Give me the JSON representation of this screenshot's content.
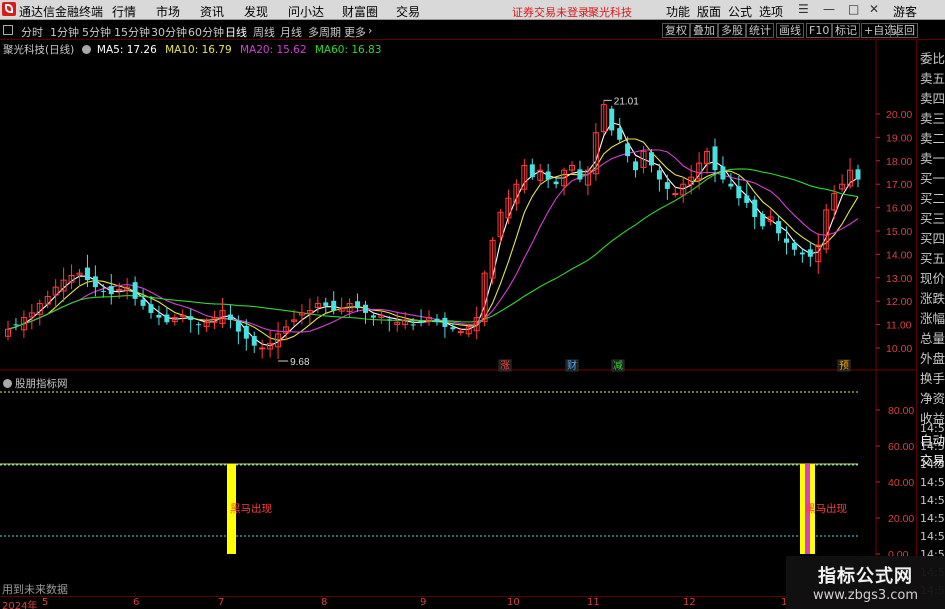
{
  "menubar": {
    "app_name": "通达信金融终端",
    "items": [
      "行情",
      "市场",
      "资讯",
      "发现",
      "问小达",
      "财富圈",
      "交易"
    ],
    "notice": "证券交易未登录",
    "stock_name": "聚光科技",
    "right_items": [
      "功能",
      "版面",
      "公式",
      "选项"
    ],
    "guest": "游客"
  },
  "toolbar": {
    "periods": [
      "分时",
      "1分钟",
      "5分钟",
      "15分钟",
      "30分钟",
      "60分钟",
      "日线",
      "周线",
      "月线",
      "多周期",
      "更多"
    ],
    "active_period": "日线",
    "right_buttons": [
      "复权",
      "叠加",
      "多股",
      "统计",
      "画线",
      "F10",
      "标记",
      "+自选",
      "返回"
    ]
  },
  "main_title": {
    "stock": "聚光科技(日线)",
    "ma5": "MA5: 17.26",
    "ma10": "MA10: 16.79",
    "ma20": "MA20: 15.62",
    "ma60": "MA60: 16.83",
    "colors": {
      "ma5": "#ffffff",
      "ma10": "#e8e64a",
      "ma20": "#d63fd6",
      "ma60": "#2ed82e",
      "up": "#ff3b3b",
      "down": "#4be0e0"
    }
  },
  "price_axis": [
    "20.00",
    "19.00",
    "18.00",
    "17.00",
    "16.00",
    "15.00",
    "14.00",
    "13.00",
    "12.00",
    "11.00",
    "10.00"
  ],
  "annotations": {
    "high": "21.01",
    "low": "9.68"
  },
  "event_markers": [
    {
      "text": "涨",
      "color": "#ff4040"
    },
    {
      "text": "财",
      "color": "#4bb0ff"
    },
    {
      "text": "减",
      "color": "#2ed82e"
    },
    {
      "text": "预",
      "color": "#ffaa00"
    }
  ],
  "subchart": {
    "title": "股朋指标网",
    "axis": [
      "80.00",
      "60.00",
      "40.00",
      "20.00",
      "0.00"
    ],
    "signal_label": "黑马出现"
  },
  "right_column": {
    "labels": [
      "委比",
      "卖五",
      "卖四",
      "卖三",
      "卖二",
      "卖一",
      "买一",
      "买二",
      "买三",
      "买四",
      "买五",
      "现价",
      "涨跌",
      "涨幅",
      "总量",
      "外盘",
      "换手",
      "净资",
      "收益",
      "自动",
      "交易"
    ],
    "times": [
      "14:56",
      "14:56",
      "14:56",
      "14:56",
      "14:56",
      "14:56",
      "14:56",
      "14:56",
      "14:56",
      "14:56"
    ]
  },
  "bottom_note": "用到未来数据",
  "x_axis": [
    "2024年",
    "5",
    "6",
    "7",
    "8",
    "9",
    "10",
    "11",
    "12",
    "1"
  ],
  "watermark": {
    "title": "指标公式网",
    "url": "www.zbgs3.com"
  },
  "chart_data": {
    "type": "candlestick",
    "price_range": [
      9.5,
      21.2
    ],
    "candles_close_approx": [
      10.8,
      11.0,
      11.3,
      11.5,
      11.9,
      12.2,
      12.6,
      12.9,
      13.1,
      13.2,
      12.9,
      12.6,
      12.4,
      12.3,
      12.5,
      12.6,
      12.1,
      11.8,
      11.5,
      11.3,
      11.1,
      11.3,
      11.4,
      11.2,
      11.0,
      11.1,
      11.3,
      11.6,
      11.2,
      10.7,
      10.4,
      10.1,
      10.0,
      10.2,
      10.6,
      10.9,
      11.2,
      11.5,
      11.6,
      11.9,
      11.8,
      11.6,
      11.7,
      11.9,
      11.7,
      11.5,
      11.3,
      11.4,
      11.2,
      11.1,
      11.2,
      11.0,
      11.1,
      11.3,
      11.1,
      10.9,
      10.8,
      10.7,
      10.9,
      11.3,
      13.2,
      14.6,
      15.8,
      16.4,
      17.0,
      17.8,
      17.3,
      17.6,
      17.2,
      17.0,
      17.6,
      17.8,
      17.2,
      17.6,
      19.2,
      20.4,
      19.3,
      18.9,
      18.2,
      17.6,
      18.4,
      17.8,
      17.2,
      16.8,
      16.6,
      17.0,
      17.3,
      17.9,
      18.4,
      17.6,
      17.2,
      16.9,
      16.4,
      16.2,
      15.6,
      15.2,
      15.6,
      14.9,
      14.5,
      14.2,
      14.0,
      13.9,
      14.4,
      15.9,
      16.6,
      17.0,
      17.6,
      17.2
    ]
  }
}
